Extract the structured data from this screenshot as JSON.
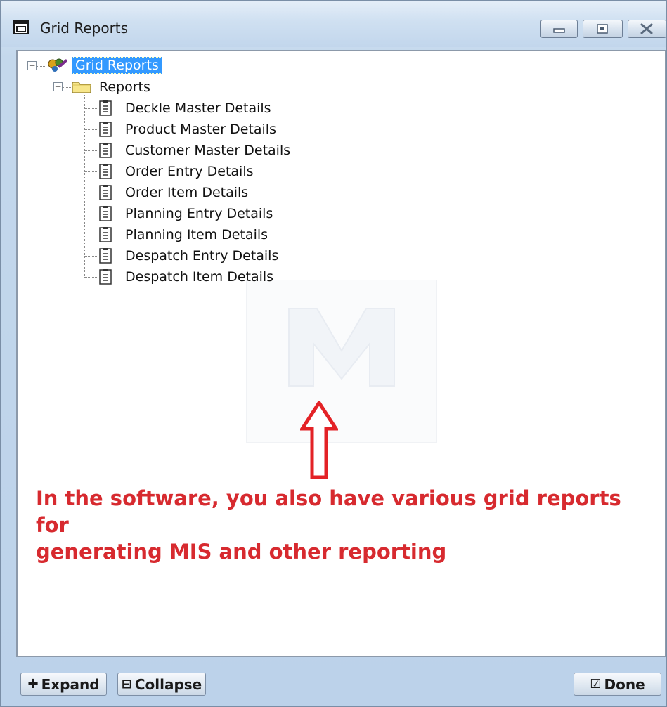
{
  "window": {
    "title": "Grid Reports"
  },
  "tree": {
    "root": "Grid Reports",
    "folder": "Reports",
    "items": [
      "Deckle Master Details",
      "Product Master Details",
      "Customer Master Details",
      "Order Entry Details",
      "Order Item Details",
      "Planning Entry Details",
      "Planning Item Details",
      "Despatch Entry Details",
      "Despatch Item Details"
    ]
  },
  "annotation": {
    "line1": "In the software, you also have various grid reports for",
    "line2": "generating MIS and other reporting",
    "color": "#d72a2f"
  },
  "buttons": {
    "expand": "Expand",
    "collapse": "Collapse",
    "done": "Done"
  },
  "colors": {
    "selection": "#3399ff",
    "frame": "#c4d8ec"
  }
}
